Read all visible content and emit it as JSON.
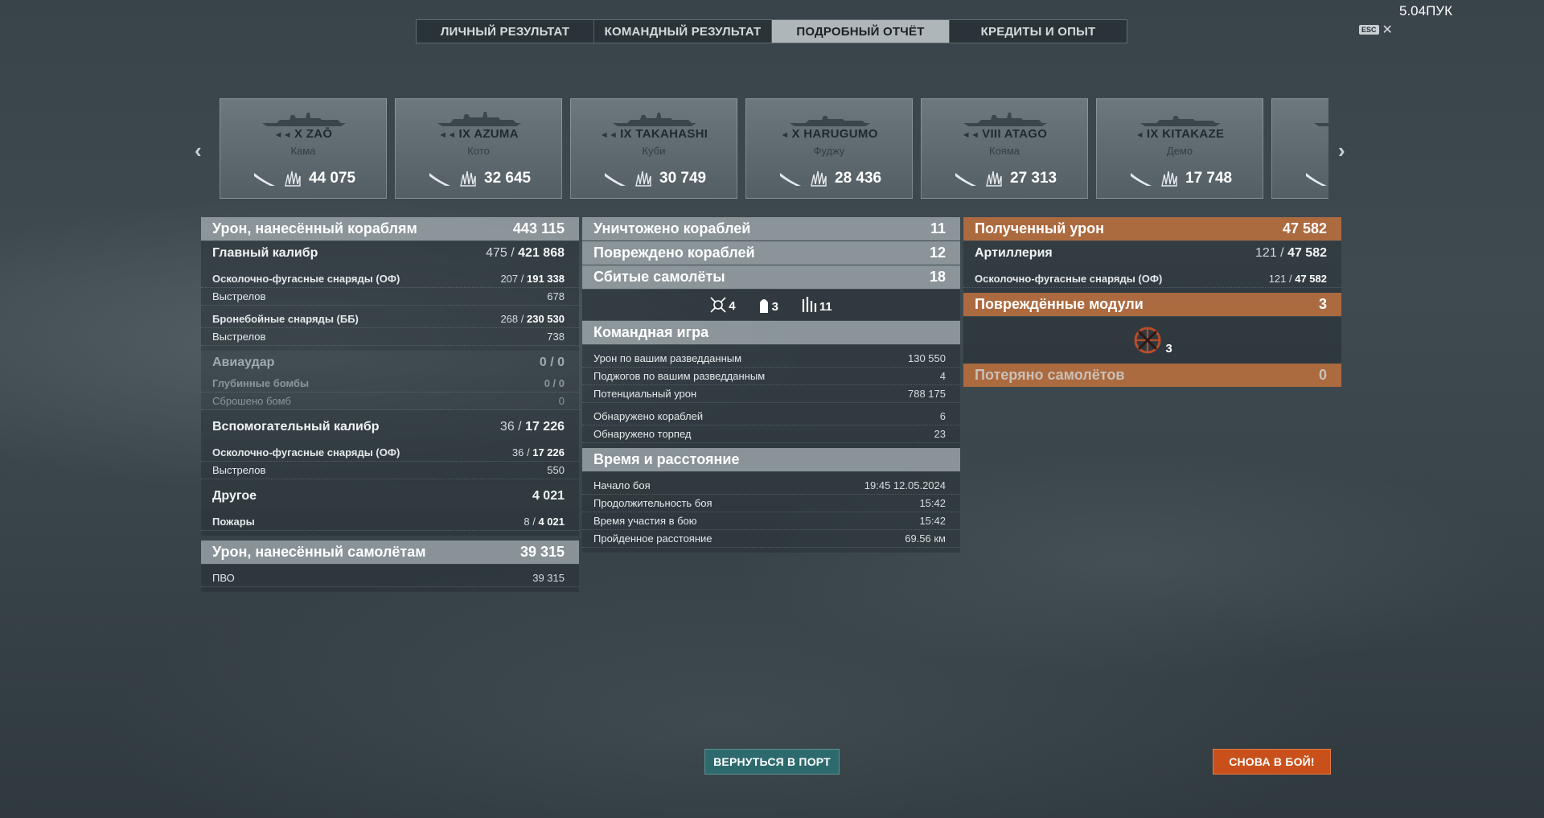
{
  "tabs": [
    {
      "label": "ЛИЧНЫЙ РЕЗУЛЬТАТ",
      "active": false
    },
    {
      "label": "КОМАНДНЫЙ РЕЗУЛЬТАТ",
      "active": false
    },
    {
      "label": "ПОДРОБНЫЙ ОТЧЁТ",
      "active": true
    },
    {
      "label": "КРЕДИТЫ И ОПЫТ",
      "active": false
    }
  ],
  "fps": "5.04ПУК",
  "esc": {
    "key": "ESC",
    "close": "✕"
  },
  "carousel": {
    "prev_icon": "chevron-left-icon",
    "next_icon": "chevron-right-icon",
    "ships": [
      {
        "tier": "X",
        "name": "ZAŌ",
        "player": "Кама",
        "damage": "44 075"
      },
      {
        "tier": "IX",
        "name": "AZUMA",
        "player": "Кото",
        "damage": "32 645"
      },
      {
        "tier": "IX",
        "name": "TAKAHASHI",
        "player": "Куби",
        "damage": "30 749"
      },
      {
        "tier": "X",
        "name": "HARUGUMO",
        "player": "Фуджу",
        "damage": "28 436"
      },
      {
        "tier": "VIII",
        "name": "ATAGO",
        "player": "Коямa",
        "damage": "27 313"
      },
      {
        "tier": "IX",
        "name": "KITAKAZE",
        "player": "Демо",
        "damage": "17 748"
      }
    ]
  },
  "left": {
    "dmg_ships": {
      "label": "Урон, нанесённый кораблям",
      "value": "443 115"
    },
    "main_battery": {
      "label": "Главный калибр",
      "hits": "475 /",
      "value": "421 868"
    },
    "he": {
      "label": "Осколочно-фугасные снаряды (ОФ)",
      "hits": "207 /",
      "value": "191 338"
    },
    "he_shots": {
      "label": "Выстрелов",
      "value": "678"
    },
    "ap": {
      "label": "Бронебойные снаряды (ББ)",
      "hits": "268 /",
      "value": "230 530"
    },
    "ap_shots": {
      "label": "Выстрелов",
      "value": "738"
    },
    "airstrike": {
      "label": "Авиаудар",
      "value": "0 / 0"
    },
    "depth": {
      "label": "Глубинные бомбы",
      "value": "0 / 0"
    },
    "bombs": {
      "label": "Сброшено бомб",
      "value": "0"
    },
    "secondary": {
      "label": "Вспомогательный калибр",
      "hits": "36 /",
      "value": "17 226"
    },
    "sec_he": {
      "label": "Осколочно-фугасные снаряды (ОФ)",
      "hits": "36 /",
      "value": "17 226"
    },
    "sec_shots": {
      "label": "Выстрелов",
      "value": "550"
    },
    "other": {
      "label": "Другое",
      "value": "4 021"
    },
    "fires": {
      "label": "Пожары",
      "hits": "8 /",
      "value": "4 021"
    },
    "dmg_planes": {
      "label": "Урон, нанесённый самолётам",
      "value": "39 315"
    },
    "aa": {
      "label": "ПВО",
      "value": "39 315"
    }
  },
  "middle": {
    "destroyed": {
      "label": "Уничтожено кораблей",
      "value": "11"
    },
    "damaged": {
      "label": "Повреждено кораблей",
      "value": "12"
    },
    "planes": {
      "label": "Сбитые самолёты",
      "value": "18"
    },
    "ribbons": [
      {
        "icon": "crosshair-icon",
        "count": "4"
      },
      {
        "icon": "shell-icon",
        "count": "3"
      },
      {
        "icon": "ribbon-bars-icon",
        "count": "11"
      }
    ],
    "team": {
      "label": "Командная игра"
    },
    "team_rows": [
      {
        "label": "Урон по вашим разведданным",
        "value": "130 550"
      },
      {
        "label": "Поджогов по вашим разведданным",
        "value": "4"
      },
      {
        "label": "Потенциальный урон",
        "value": "788 175"
      },
      {
        "label": "Обнаружено кораблей",
        "value": "6"
      },
      {
        "label": "Обнаружено торпед",
        "value": "23"
      }
    ],
    "time": {
      "label": "Время и расстояние"
    },
    "time_rows": [
      {
        "label": "Начало боя",
        "value": "19:45  12.05.2024"
      },
      {
        "label": "Продолжительность боя",
        "value": "15:42"
      },
      {
        "label": "Время участия в бою",
        "value": "15:42"
      },
      {
        "label": "Пройденное расстояние",
        "value": "69.56 км"
      }
    ]
  },
  "right": {
    "received": {
      "label": "Полученный урон",
      "value": "47 582"
    },
    "artillery": {
      "label": "Артиллерия",
      "hits": "121 /",
      "value": "47 582"
    },
    "art_he": {
      "label": "Осколочно-фугасные снаряды (ОФ)",
      "hits": "121 /",
      "value": "47 582"
    },
    "modules": {
      "label": "Повреждённые модули",
      "value": "3"
    },
    "module_icon": {
      "icon": "damaged-rudder-icon",
      "count": "3"
    },
    "lost_planes": {
      "label": "Потеряно самолётов",
      "value": "0"
    }
  },
  "buttons": {
    "port": "ВЕРНУТЬСЯ В ПОРТ",
    "battle": "СНОВА В БОЙ!"
  },
  "colors": {
    "accent_orange": "#c9501a",
    "port_teal": "#2d6a6d",
    "header_orange": "#bc6e3e"
  }
}
